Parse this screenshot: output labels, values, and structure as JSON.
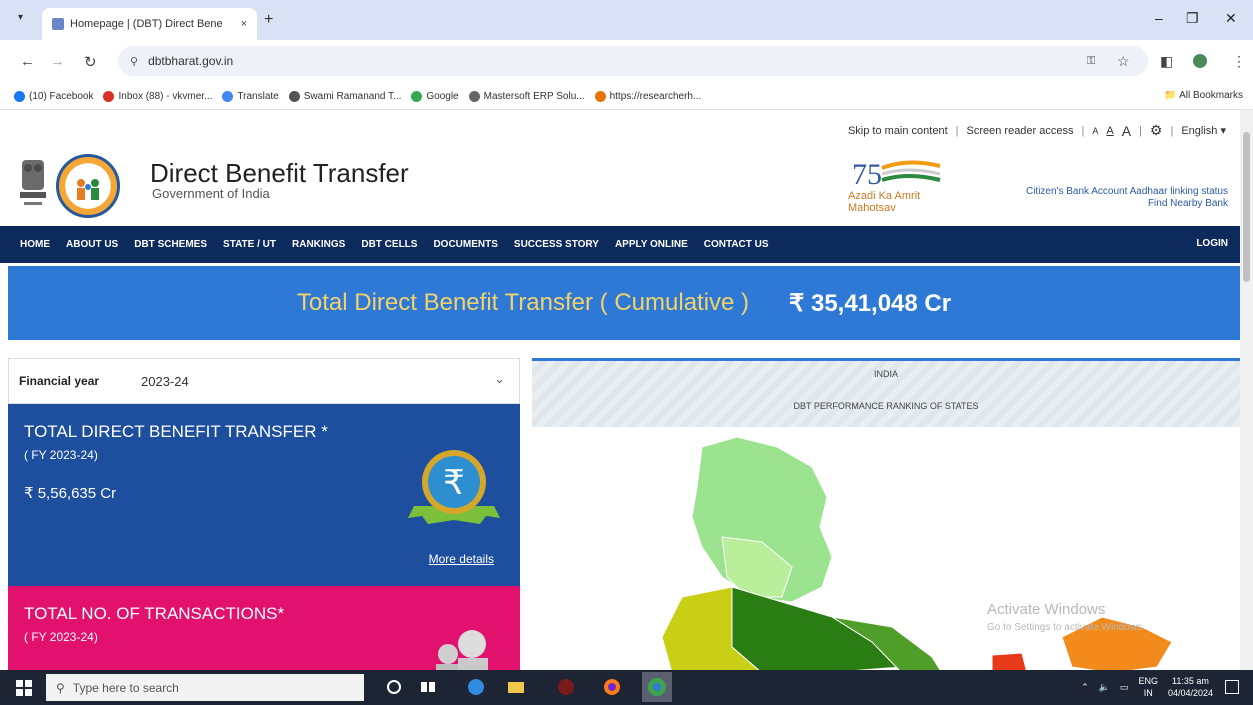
{
  "browser": {
    "tab_title": "Homepage | (DBT) Direct Bene",
    "tab_close": "×",
    "new_tab": "+",
    "tab_menu": "▾",
    "url": "dbtbharat.gov.in",
    "bookmarks": [
      {
        "label": "(10) Facebook",
        "color": "#1877f2"
      },
      {
        "label": "Inbox (88) - vkvmer...",
        "color": "#d93025"
      },
      {
        "label": "Translate",
        "color": "#4285f4"
      },
      {
        "label": "Swami Ramanand T...",
        "color": "#555555"
      },
      {
        "label": "Google",
        "color": "#34a853"
      },
      {
        "label": "Mastersoft ERP Solu...",
        "color": "#666666"
      },
      {
        "label": "https://researcherh...",
        "color": "#e8710a"
      }
    ],
    "all_bookmarks": "All Bookmarks"
  },
  "utility": {
    "skip": "Skip to main content",
    "screen_reader": "Screen reader access",
    "font_small": "A",
    "font_normal": "A",
    "font_large": "A",
    "language": "English ▾"
  },
  "header": {
    "title": "Direct Benefit Transfer",
    "subtitle": "Government of India",
    "azadi_text": "Azadi Ka Amrit Mahotsav",
    "citizen_link": "Citizen's Bank Account Aadhaar linking status",
    "nearby_link": "Find Nearby Bank"
  },
  "nav": {
    "items": [
      "HOME",
      "ABOUT US",
      "DBT SCHEMES",
      "STATE / UT",
      "RANKINGS",
      "DBT CELLS",
      "DOCUMENTS",
      "SUCCESS STORY",
      "APPLY ONLINE",
      "CONTACT US"
    ],
    "login": "LOGIN"
  },
  "banner": {
    "label": "Total Direct Benefit Transfer ( Cumulative )",
    "value": "₹ 35,41,048 Cr"
  },
  "financial_year": {
    "label": "Financial year",
    "value": "2023-24"
  },
  "cards": {
    "dbt": {
      "title": "TOTAL DIRECT BENEFIT TRANSFER *",
      "period": "( FY 2023-24)",
      "amount": "₹ 5,56,635 Cr",
      "more": "More details",
      "color": "#1d4f9e"
    },
    "transactions": {
      "title": "TOTAL NO. OF TRANSACTIONS*",
      "period": "( FY 2023-24)",
      "color": "#e2116e"
    }
  },
  "map": {
    "title": "INDIA",
    "subtitle": "DBT PERFORMANCE RANKING OF STATES"
  },
  "watermark": {
    "line1": "Activate Windows",
    "line2": "Go to Settings to activate Windows."
  },
  "taskbar": {
    "search_placeholder": "Type here to search",
    "lang": "ENG",
    "region": "IN",
    "time": "11:35 am",
    "date": "04/04/2024"
  }
}
